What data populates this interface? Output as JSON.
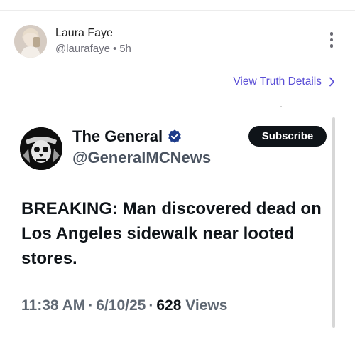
{
  "post": {
    "author_name": "Laura Faye",
    "author_handle": "@laurafaye",
    "time_ago": "5h",
    "separator": "•",
    "more_icon": "more-vertical-icon"
  },
  "details_link": {
    "label": "View Truth Details",
    "icon": "chevron-right-icon"
  },
  "embedded_post": {
    "display_name": "The General",
    "verified_icon": "verified-badge-icon",
    "handle": "@GeneralMCNews",
    "subscribe_label": "Subscribe",
    "text": "BREAKING: Man discovered dead on Los Angeles sidewalk near looted stores.",
    "time": "11:38 AM",
    "date": "6/10/25",
    "views_count": "628",
    "views_label": "Views",
    "meta_separator": "·"
  },
  "colors": {
    "link": "#5b4fd6",
    "verified": "#1d3b8a",
    "text_dark": "#0f1419",
    "muted": "#70707a"
  }
}
